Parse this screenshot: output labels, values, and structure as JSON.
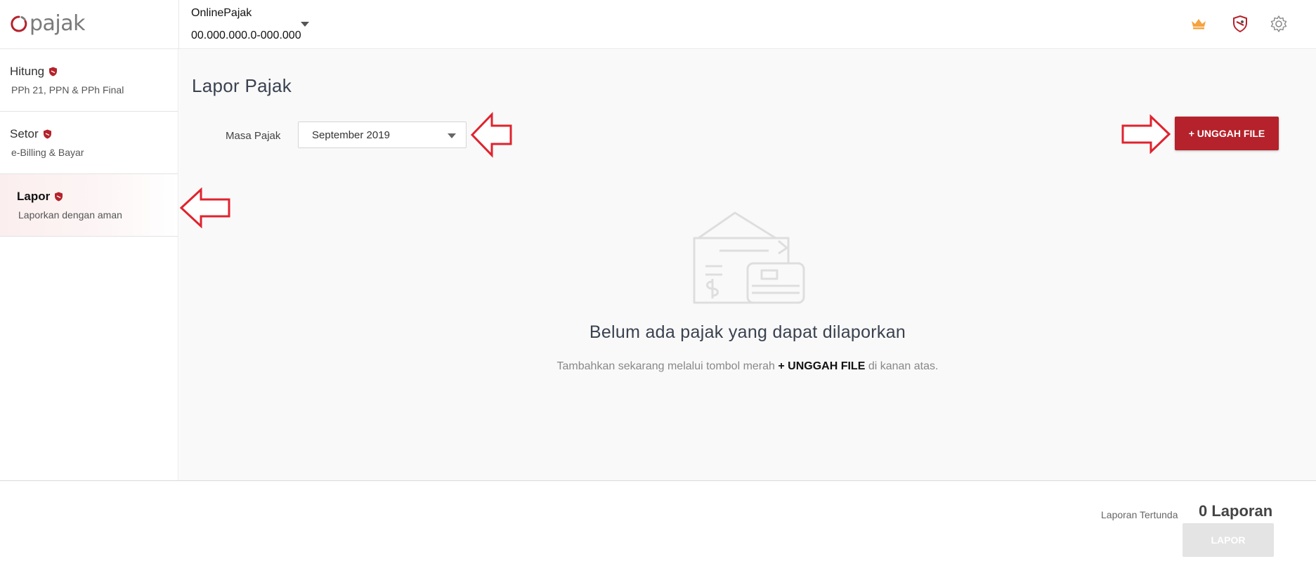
{
  "header": {
    "logo_text": "pajak",
    "company_name": "OnlinePajak",
    "company_npwp": "00.000.000.0-000.000",
    "icons": [
      "crown-icon",
      "shield-icon",
      "gear-icon"
    ]
  },
  "sidebar": {
    "items": [
      {
        "title": "Hitung",
        "subtitle": "PPh 21, PPN & PPh Final",
        "active": false
      },
      {
        "title": "Setor",
        "subtitle": "e-Billing & Bayar",
        "active": false
      },
      {
        "title": "Lapor",
        "subtitle": "Laporkan dengan aman",
        "active": true
      }
    ]
  },
  "main": {
    "page_title": "Lapor Pajak",
    "masa_label": "Masa Pajak",
    "masa_value": "September 2019",
    "upload_label": "+ UNGGAH FILE",
    "empty_title": "Belum ada pajak yang dapat dilaporkan",
    "empty_desc_prefix": "Tambahkan sekarang melalui tombol merah ",
    "empty_desc_bold": "+ UNGGAH FILE",
    "empty_desc_suffix": " di kanan atas."
  },
  "footer": {
    "pending_label": "Laporan Tertunda",
    "pending_count": "0 Laporan",
    "lapor_label": "LAPOR"
  },
  "colors": {
    "brand_red": "#b5222b",
    "annotation_red": "#e0232e",
    "crown": "#f4a340"
  }
}
